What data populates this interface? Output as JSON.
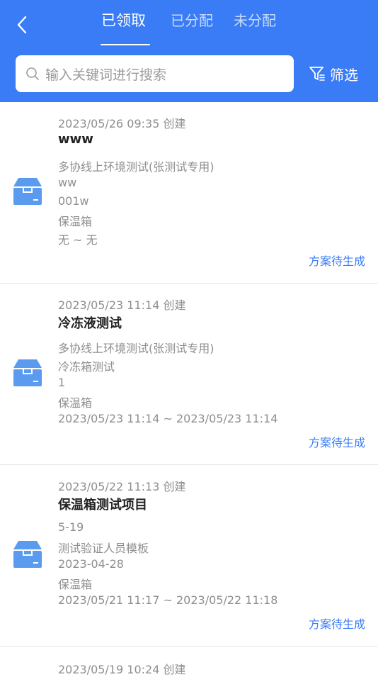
{
  "header": {
    "tabs": [
      {
        "label": "已领取",
        "active": true
      },
      {
        "label": "已分配",
        "active": false
      },
      {
        "label": "未分配",
        "active": false
      }
    ],
    "search_placeholder": "输入关键词进行搜索",
    "filter_label": "筛选"
  },
  "items": [
    {
      "created": "2023/05/26 09:35 创建",
      "title": "www",
      "lines": [
        "多协线上环境测试(张测试专用)",
        "ww",
        "001w",
        "保温箱",
        "无 ~ 无"
      ],
      "status": "方案待生成"
    },
    {
      "created": "2023/05/23 11:14 创建",
      "title": "冷冻液测试",
      "lines": [
        "多协线上环境测试(张测试专用)",
        "冷冻箱测试",
        "1",
        "保温箱",
        "2023/05/23 11:14 ~ 2023/05/23 11:14"
      ],
      "status": "方案待生成"
    },
    {
      "created": "2023/05/22 11:13 创建",
      "title": "保温箱测试项目",
      "lines": [
        "5-19",
        "测试验证人员模板",
        "2023-04-28",
        "保温箱",
        "2023/05/21 11:17 ~ 2023/05/22 11:18"
      ],
      "status": "方案待生成"
    }
  ],
  "partial_item": {
    "created": "2023/05/19 10:24 创建"
  },
  "colors": {
    "header_bg": "#3a7cf5",
    "status": "#3a7cf5",
    "icon": "#5a9bf0"
  }
}
